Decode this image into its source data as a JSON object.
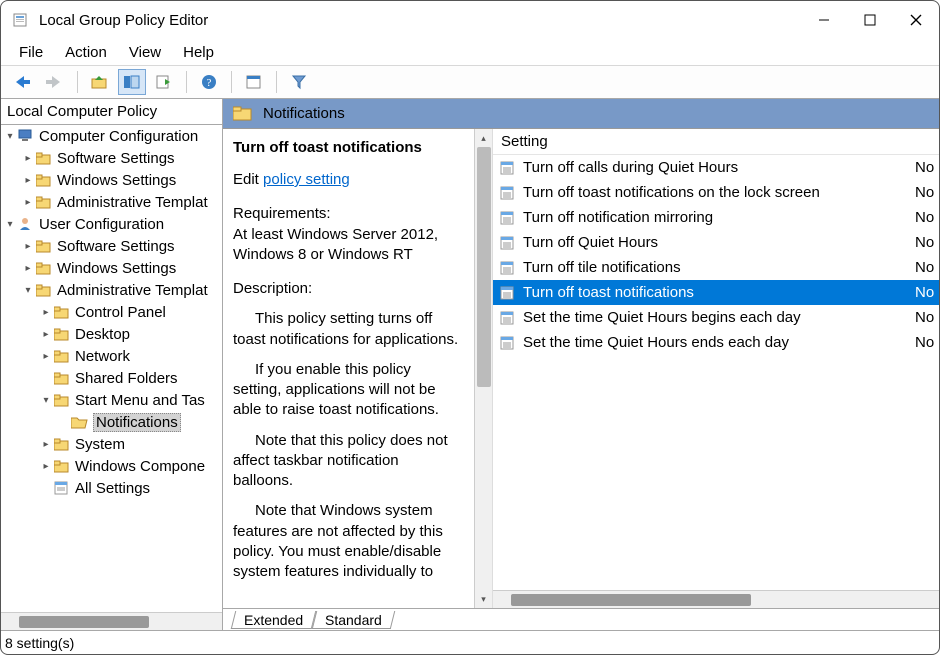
{
  "window": {
    "title": "Local Group Policy Editor"
  },
  "menubar": [
    "File",
    "Action",
    "View",
    "Help"
  ],
  "tree": {
    "header": "Local Computer Policy",
    "rows": [
      {
        "indent": 0,
        "twisty": "▾",
        "icon": "computer",
        "label": "Computer Configuration",
        "sel": false
      },
      {
        "indent": 1,
        "twisty": "▸",
        "icon": "folder",
        "label": "Software Settings",
        "sel": false
      },
      {
        "indent": 1,
        "twisty": "▸",
        "icon": "folder",
        "label": "Windows Settings",
        "sel": false
      },
      {
        "indent": 1,
        "twisty": "▸",
        "icon": "folder",
        "label": "Administrative Templat",
        "sel": false
      },
      {
        "indent": 0,
        "twisty": "▾",
        "icon": "user",
        "label": "User Configuration",
        "sel": false
      },
      {
        "indent": 1,
        "twisty": "▸",
        "icon": "folder",
        "label": "Software Settings",
        "sel": false
      },
      {
        "indent": 1,
        "twisty": "▸",
        "icon": "folder",
        "label": "Windows Settings",
        "sel": false
      },
      {
        "indent": 1,
        "twisty": "▾",
        "icon": "folder",
        "label": "Administrative Templat",
        "sel": false
      },
      {
        "indent": 2,
        "twisty": "▸",
        "icon": "folder",
        "label": "Control Panel",
        "sel": false
      },
      {
        "indent": 2,
        "twisty": "▸",
        "icon": "folder",
        "label": "Desktop",
        "sel": false
      },
      {
        "indent": 2,
        "twisty": "▸",
        "icon": "folder",
        "label": "Network",
        "sel": false
      },
      {
        "indent": 2,
        "twisty": "",
        "icon": "folder",
        "label": "Shared Folders",
        "sel": false
      },
      {
        "indent": 2,
        "twisty": "▾",
        "icon": "folder",
        "label": "Start Menu and Tas",
        "sel": false
      },
      {
        "indent": 3,
        "twisty": "",
        "icon": "folder-open",
        "label": "Notifications",
        "sel": true
      },
      {
        "indent": 2,
        "twisty": "▸",
        "icon": "folder",
        "label": "System",
        "sel": false
      },
      {
        "indent": 2,
        "twisty": "▸",
        "icon": "folder",
        "label": "Windows Compone",
        "sel": false
      },
      {
        "indent": 2,
        "twisty": "",
        "icon": "allsettings",
        "label": "All Settings",
        "sel": false
      }
    ]
  },
  "path_header": "Notifications",
  "description": {
    "title": "Turn off toast notifications",
    "edit_prefix": "Edit ",
    "edit_link": "policy setting",
    "requirements_label": "Requirements:",
    "requirements_text": "At least Windows Server 2012, Windows 8 or Windows RT",
    "description_label": "Description:",
    "paragraphs": [
      "This policy setting turns off toast notifications for applications.",
      "If you enable this policy setting, applications will not be able to raise toast notifications.",
      "Note that this policy does not affect taskbar notification balloons.",
      "Note that Windows system features are not affected by this policy.  You must enable/disable system features individually to"
    ]
  },
  "list": {
    "column_header": "Setting",
    "rows": [
      {
        "label": "Turn off calls during Quiet Hours",
        "state": "No",
        "sel": false
      },
      {
        "label": "Turn off toast notifications on the lock screen",
        "state": "No",
        "sel": false
      },
      {
        "label": "Turn off notification mirroring",
        "state": "No",
        "sel": false
      },
      {
        "label": "Turn off Quiet Hours",
        "state": "No",
        "sel": false
      },
      {
        "label": "Turn off tile notifications",
        "state": "No",
        "sel": false
      },
      {
        "label": "Turn off toast notifications",
        "state": "No",
        "sel": true
      },
      {
        "label": "Set the time Quiet Hours begins each day",
        "state": "No",
        "sel": false
      },
      {
        "label": "Set the time Quiet Hours ends each day",
        "state": "No",
        "sel": false
      }
    ]
  },
  "tabs": {
    "extended": "Extended",
    "standard": "Standard"
  },
  "statusbar": "8 setting(s)"
}
